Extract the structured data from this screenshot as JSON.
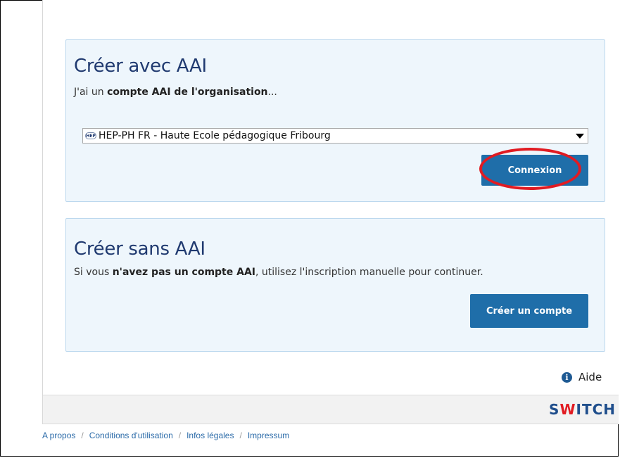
{
  "aai_panel": {
    "title": "Créer avec AAI",
    "text_prefix": "J'ai un ",
    "text_bold": "compte AAI de l'organisation",
    "text_suffix": "...",
    "organization_select_value": "HEP-PH FR - Haute Ecole pédagogique Fribourg",
    "org_logo_text": "HEP",
    "button_label": "Connexion"
  },
  "no_aai_panel": {
    "title": "Créer sans AAI",
    "text_prefix": "Si vous ",
    "text_bold": "n'avez pas un compte AAI",
    "text_suffix": ", utilisez l'inscription manuelle pour continuer.",
    "button_label": "Créer un compte"
  },
  "help": {
    "label": "Aide",
    "icon": "info-icon"
  },
  "brand": {
    "logo_prefix": "S",
    "logo_w": "W",
    "logo_suffix": "ITCH"
  },
  "footer_links": [
    "A propos",
    "Conditions d'utilisation",
    "Infos légales",
    "Impressum"
  ],
  "footer_separator": "/",
  "colors": {
    "accent": "#1f6ea9",
    "title": "#203a70",
    "panel_bg": "#eef6fc",
    "highlight_ring": "#e11b22"
  }
}
